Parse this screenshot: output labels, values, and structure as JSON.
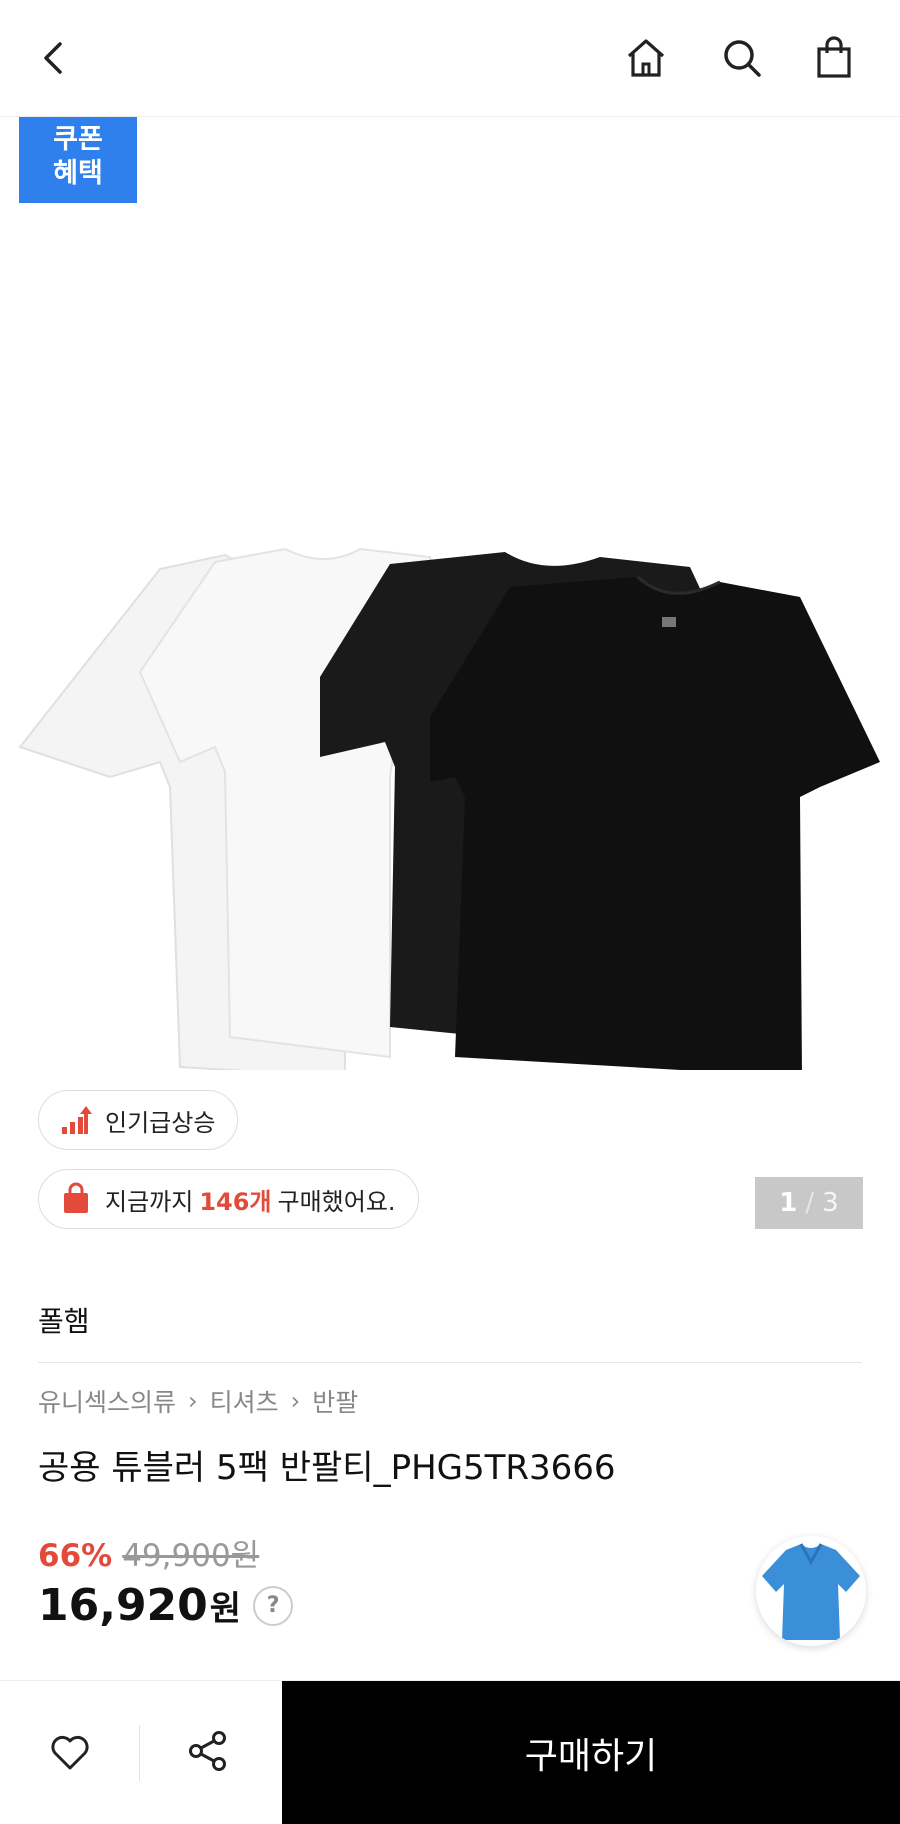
{
  "header": {
    "icons": [
      "chevron-left-icon",
      "home-icon",
      "search-icon",
      "shopping-bag-icon"
    ]
  },
  "coupon": {
    "line1": "쿠폰",
    "line2": "혜택",
    "color": "#2f80ed"
  },
  "badges": {
    "popular": {
      "text": "인기급상승",
      "icon": "trending-up-icon"
    },
    "bought": {
      "prefix": "지금까지",
      "count": "146개",
      "suffix": "구매했어요.",
      "icon": "shopping-bag-icon"
    }
  },
  "pager": {
    "current": "1",
    "separator": "/",
    "total": "3"
  },
  "product": {
    "brand": "폴햄",
    "breadcrumb": [
      "유니섹스의류",
      "티셔츠",
      "반팔"
    ],
    "title": "공용 튜블러 5팩 반팔티_PHG5TR3666",
    "discount_rate": "66%",
    "original_price": "49,900원",
    "price": "16,920",
    "currency": "원",
    "help": "?"
  },
  "bottom_bar": {
    "wish_icon": "heart-icon",
    "share_icon": "share-icon",
    "buy_label": "구매하기"
  },
  "colors": {
    "accent_red": "#e24b3b",
    "buy_bg": "#000000",
    "pager_bg": "#c8c8c8"
  }
}
